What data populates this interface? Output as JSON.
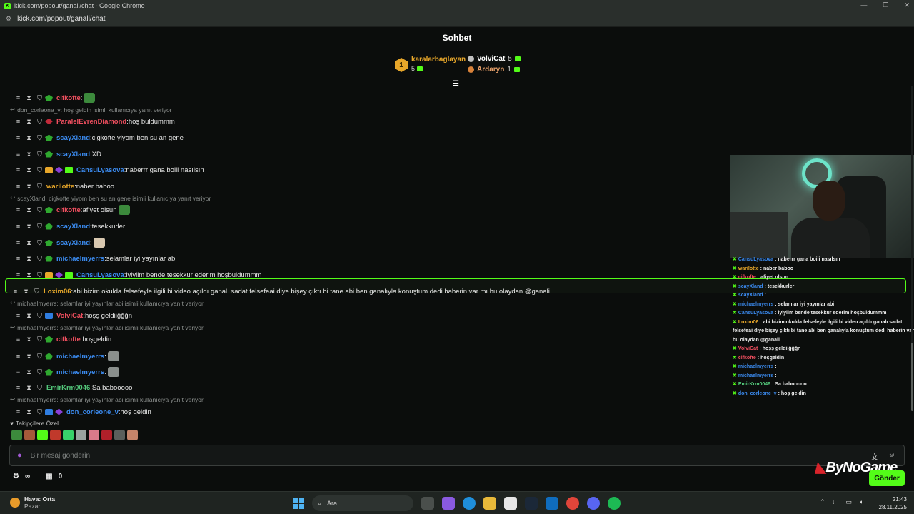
{
  "browser": {
    "title": "kick.com/popout/ganali/chat - Google Chrome",
    "url": "kick.com/popout/ganali/chat"
  },
  "header": {
    "title": "Sohbet"
  },
  "leaderboard": {
    "first": {
      "rank": "1",
      "name": "karalarbaglayan",
      "count": "5"
    },
    "second": {
      "name": "VolviCat",
      "count": "5"
    },
    "third": {
      "name": "Ardaryn",
      "count": "1"
    }
  },
  "messages": [
    {
      "user": "cifkofte",
      "text": "",
      "color": "#f04f5f"
    },
    {
      "reply": "don_corleone_v: hoş geldin isimli kullanıcıya yanıt veriyor"
    },
    {
      "user": "ParalelEvrenDiamond",
      "text": "hoş buldummm",
      "color": "#f04f5f"
    },
    {
      "user": "scayXland",
      "text": "cigkofte yiyom ben su an gene",
      "color": "#3b8bf0"
    },
    {
      "user": "scayXland",
      "text": "XD",
      "color": "#3b8bf0"
    },
    {
      "user": "CansuLyasova",
      "text": "naberrr gana boiii nasılsın",
      "color": "#3b8bf0"
    },
    {
      "user": "warilotte",
      "text": "naber baboo",
      "color": "#e8a72a"
    },
    {
      "reply": "scayXland: cigkofte yiyom ben su an gene isimli kullanıcıya yanıt veriyor"
    },
    {
      "user": "cifkofte",
      "text": "afiyet olsun",
      "color": "#f04f5f"
    },
    {
      "user": "scayXland",
      "text": "tesekkurler",
      "color": "#3b8bf0"
    },
    {
      "user": "scayXland",
      "text": "",
      "color": "#3b8bf0"
    },
    {
      "user": "michaelmyerrs",
      "text": "selamlar iyi yayınlar abi",
      "color": "#3b8bf0"
    },
    {
      "user": "CansuLyasova",
      "text": "iyiyiim bende tesekkur ederim hoşbuldummm",
      "color": "#3b8bf0"
    },
    {
      "user": "Loxim06",
      "text": "abi bizim okulda felsefeyle ilgili bi video açıldı ganalı sadat felsefeai diye bişey çıktı bi tane abi ben ganalıyla konuştum dedi haberin var mı bu olaydan @ganali",
      "color": "#e8a72a"
    },
    {
      "reply": "michaelmyerrs: selamlar iyi yayınlar abi isimli kullanıcıya yanıt veriyor"
    },
    {
      "user": "VolviCat",
      "text": "hoşş geldiiğğğn",
      "color": "#f04f5f"
    },
    {
      "reply": "michaelmyerrs: selamlar iyi yayınlar abi isimli kullanıcıya yanıt veriyor"
    },
    {
      "user": "cifkofte",
      "text": "hoşgeldin",
      "color": "#f04f5f"
    },
    {
      "user": "michaelmyerrs",
      "text": "",
      "color": "#3b8bf0"
    },
    {
      "user": "michaelmyerrs",
      "text": "",
      "color": "#3b8bf0"
    },
    {
      "user": "EmirKrm0046",
      "text": "Sa babooooo",
      "color": "#53c77a"
    },
    {
      "reply": "michaelmyerrs: selamlar iyi yayınlar abi isimli kullanıcıya yanıt veriyor"
    },
    {
      "user": "don_corleone_v",
      "text": "hoş geldin",
      "color": "#3b8bf0"
    }
  ],
  "overlay": [
    {
      "user": "CansuLyasova",
      "text": "naberrr gana boiii nasılsın",
      "color": "#3b8bf0"
    },
    {
      "user": "warilotte",
      "text": "naber baboo",
      "color": "#e8a72a"
    },
    {
      "user": "cifkofte",
      "text": "afiyet olsun",
      "color": "#f04f5f"
    },
    {
      "user": "scayXland",
      "text": "tesekkurler",
      "color": "#3b8bf0"
    },
    {
      "user": "scayXland",
      "text": "",
      "color": "#3b8bf0"
    },
    {
      "user": "michaelmyerrs",
      "text": "selamlar iyi yayınlar abi",
      "color": "#3b8bf0"
    },
    {
      "user": "CansuLyasova",
      "text": "iyiyiim bende tesekkur ederim hoşbuldummm",
      "color": "#3b8bf0"
    },
    {
      "user": "Loxim06",
      "text": "abi bizim okulda felsefeyle ilgili bi video açıldı ganalı sadat",
      "color": "#e8a72a"
    },
    {
      "user": "",
      "text": "felsefeai diye bişey çıktı bi tane abi ben ganalıyla konuştum dedi haberin var mı",
      "color": "#ffffff"
    },
    {
      "user": "",
      "text": "bu olaydan @ganali",
      "color": "#ffffff"
    },
    {
      "user": "VolviCat",
      "text": "hoşş geldiiğğğn",
      "color": "#f04f5f"
    },
    {
      "user": "cifkofte",
      "text": "hoşgeldin",
      "color": "#f04f5f"
    },
    {
      "user": "michaelmyerrs",
      "text": "",
      "color": "#3b8bf0"
    },
    {
      "user": "michaelmyerrs",
      "text": "",
      "color": "#3b8bf0"
    },
    {
      "user": "EmirKrm0046",
      "text": "Sa babooooo",
      "color": "#53c77a"
    },
    {
      "user": "don_corleone_v",
      "text": "hoş geldin",
      "color": "#3b8bf0"
    }
  ],
  "follower_label": "Takipçilere Özel",
  "input": {
    "placeholder": "Bir mesaj gönderin"
  },
  "bottom": {
    "points": "0",
    "send_label": "Gönder"
  },
  "watermark": "ByNoGame",
  "taskbar": {
    "weather_title": "Hava: Orta",
    "weather_sub": "Pazar",
    "search_label": "Ara",
    "time": "21:43",
    "date": "28.11.2025"
  },
  "colors": {
    "accent": "#53fc18",
    "background": "#0b0d0c"
  }
}
